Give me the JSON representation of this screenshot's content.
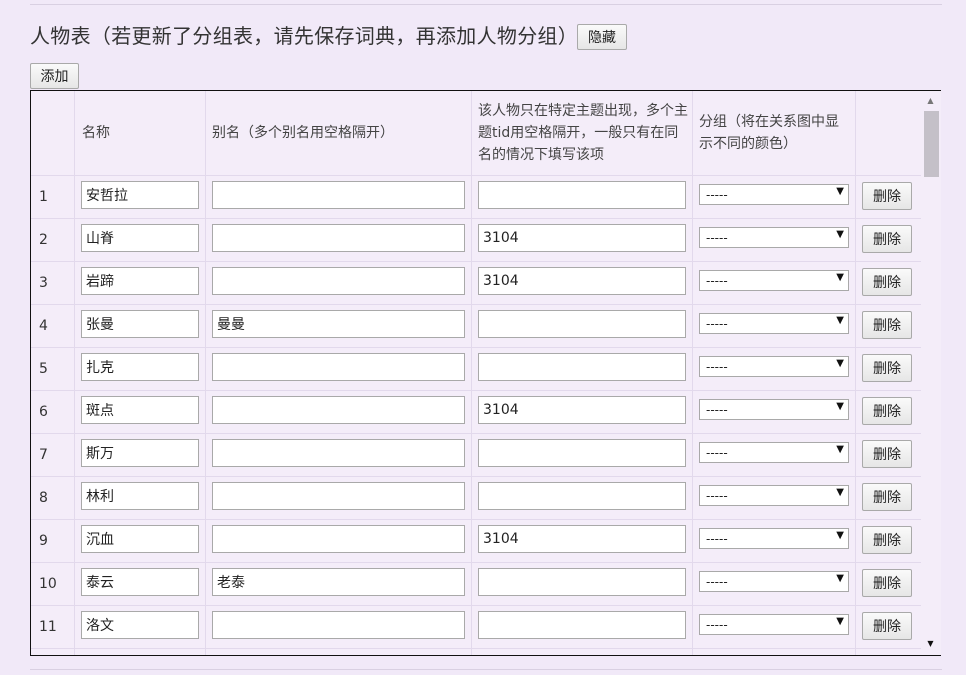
{
  "header": {
    "title": "人物表（若更新了分组表，请先保存词典，再添加人物分组）",
    "hide_label": "隐藏",
    "add_label": "添加"
  },
  "table": {
    "columns": {
      "index": "",
      "name": "名称",
      "alias": "别名（多个别名用空格隔开）",
      "topic": "该人物只在特定主题出现，多个主题tid用空格隔开，一般只有在同名的情况下填写该项",
      "group": "分组（将在关系图中显示不同的颜色）",
      "action": ""
    },
    "delete_label": "删除",
    "select_default": "-----",
    "rows": [
      {
        "num": "1",
        "name": "安哲拉",
        "alias": "",
        "topic": "",
        "group": "-----"
      },
      {
        "num": "2",
        "name": "山脊",
        "alias": "",
        "topic": "3104",
        "group": "-----"
      },
      {
        "num": "3",
        "name": "岩蹄",
        "alias": "",
        "topic": "3104",
        "group": "-----"
      },
      {
        "num": "4",
        "name": "张曼",
        "alias": "曼曼",
        "topic": "",
        "group": "-----"
      },
      {
        "num": "5",
        "name": "扎克",
        "alias": "",
        "topic": "",
        "group": "-----"
      },
      {
        "num": "6",
        "name": "斑点",
        "alias": "",
        "topic": "3104",
        "group": "-----"
      },
      {
        "num": "7",
        "name": "斯万",
        "alias": "",
        "topic": "",
        "group": "-----"
      },
      {
        "num": "8",
        "name": "林利",
        "alias": "",
        "topic": "",
        "group": "-----"
      },
      {
        "num": "9",
        "name": "沉血",
        "alias": "",
        "topic": "3104",
        "group": "-----"
      },
      {
        "num": "10",
        "name": "泰云",
        "alias": "老泰",
        "topic": "",
        "group": "-----"
      },
      {
        "num": "11",
        "name": "洛文",
        "alias": "",
        "topic": "",
        "group": "-----"
      }
    ]
  },
  "icons": {
    "scroll_up": "scroll-up-arrow-icon",
    "scroll_down": "scroll-down-arrow-icon",
    "dropdown": "chevron-down-icon"
  }
}
